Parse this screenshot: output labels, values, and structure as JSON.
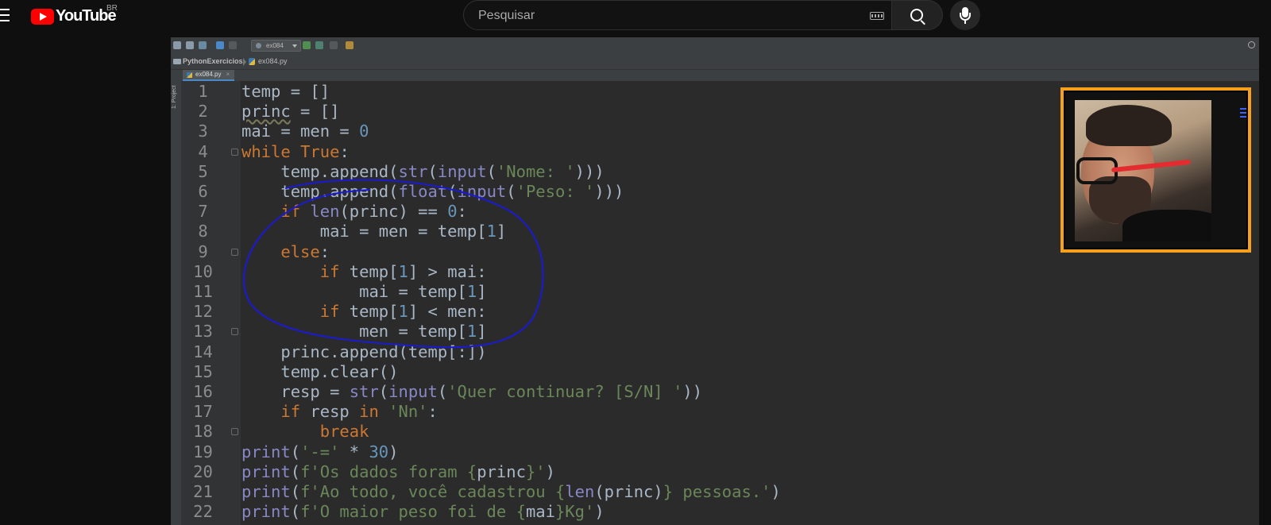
{
  "masthead": {
    "logo_text": "YouTube",
    "country": "BR",
    "search_placeholder": "Pesquisar"
  },
  "ide": {
    "run_config": "ex084",
    "breadcrumb_project": "PythonExercicios",
    "breadcrumb_file": "ex084.py",
    "tab_label": "ex084.py",
    "tab_close": "×",
    "side_label": "1: Project"
  },
  "code_lines": [
    {
      "n": "1",
      "tokens": [
        [
          "",
          "temp = []"
        ]
      ]
    },
    {
      "n": "2",
      "tokens": [
        [
          "sq",
          "princ"
        ],
        [
          "",
          " = []"
        ]
      ]
    },
    {
      "n": "3",
      "tokens": [
        [
          "",
          "mai = men = "
        ],
        [
          "num",
          "0"
        ]
      ]
    },
    {
      "n": "4",
      "tokens": [
        [
          "kw",
          "while"
        ],
        [
          "",
          " "
        ],
        [
          "kw",
          "True"
        ],
        [
          "",
          ":"
        ]
      ],
      "fold": true
    },
    {
      "n": "5",
      "tokens": [
        [
          "",
          "    temp.append("
        ],
        [
          "fn",
          "str"
        ],
        [
          "",
          "("
        ],
        [
          "fn",
          "input"
        ],
        [
          "",
          "("
        ],
        [
          "str",
          "'Nome: '"
        ],
        [
          "",
          ")))"
        ]
      ]
    },
    {
      "n": "6",
      "tokens": [
        [
          "",
          "    temp.append("
        ],
        [
          "fn",
          "float"
        ],
        [
          "",
          "("
        ],
        [
          "fn",
          "input"
        ],
        [
          "",
          "("
        ],
        [
          "str",
          "'Peso: '"
        ],
        [
          "",
          ")))"
        ]
      ]
    },
    {
      "n": "7",
      "tokens": [
        [
          "",
          "    "
        ],
        [
          "kw",
          "if"
        ],
        [
          "",
          " "
        ],
        [
          "fn",
          "len"
        ],
        [
          "",
          "(princ) == "
        ],
        [
          "num",
          "0"
        ],
        [
          "",
          ":"
        ]
      ]
    },
    {
      "n": "8",
      "tokens": [
        [
          "",
          "        mai = men = temp["
        ],
        [
          "num",
          "1"
        ],
        [
          "",
          "]"
        ]
      ]
    },
    {
      "n": "9",
      "tokens": [
        [
          "",
          "    "
        ],
        [
          "kw",
          "else"
        ],
        [
          "",
          ":"
        ]
      ],
      "fold": true
    },
    {
      "n": "10",
      "tokens": [
        [
          "",
          "        "
        ],
        [
          "kw",
          "if"
        ],
        [
          "",
          " temp["
        ],
        [
          "num",
          "1"
        ],
        [
          "",
          "] > mai:"
        ]
      ]
    },
    {
      "n": "11",
      "tokens": [
        [
          "",
          "            mai = temp["
        ],
        [
          "num",
          "1"
        ],
        [
          "",
          "]"
        ]
      ]
    },
    {
      "n": "12",
      "tokens": [
        [
          "",
          "        "
        ],
        [
          "kw",
          "if"
        ],
        [
          "",
          " temp["
        ],
        [
          "num",
          "1"
        ],
        [
          "",
          "] < men:"
        ]
      ]
    },
    {
      "n": "13",
      "tokens": [
        [
          "",
          "            men = temp["
        ],
        [
          "num",
          "1"
        ],
        [
          "",
          "]"
        ]
      ],
      "fold": true
    },
    {
      "n": "14",
      "tokens": [
        [
          "",
          "    princ.append(temp[:])"
        ]
      ]
    },
    {
      "n": "15",
      "tokens": [
        [
          "",
          "    temp.clear()"
        ]
      ]
    },
    {
      "n": "16",
      "tokens": [
        [
          "",
          "    resp = "
        ],
        [
          "fn",
          "str"
        ],
        [
          "",
          "("
        ],
        [
          "fn",
          "input"
        ],
        [
          "",
          "("
        ],
        [
          "str",
          "'Quer continuar? [S/N] '"
        ],
        [
          "",
          "))"
        ]
      ]
    },
    {
      "n": "17",
      "tokens": [
        [
          "",
          "    "
        ],
        [
          "kw",
          "if"
        ],
        [
          "",
          " resp "
        ],
        [
          "kw",
          "in"
        ],
        [
          "",
          " "
        ],
        [
          "str",
          "'Nn'"
        ],
        [
          "",
          ":"
        ]
      ]
    },
    {
      "n": "18",
      "tokens": [
        [
          "",
          "        "
        ],
        [
          "kw",
          "break"
        ]
      ],
      "fold": true
    },
    {
      "n": "19",
      "tokens": [
        [
          "fn",
          "print"
        ],
        [
          "",
          "("
        ],
        [
          "str",
          "'-='"
        ],
        [
          "",
          " * "
        ],
        [
          "num",
          "30"
        ],
        [
          "",
          ")"
        ]
      ]
    },
    {
      "n": "20",
      "tokens": [
        [
          "fn",
          "print"
        ],
        [
          "",
          "("
        ],
        [
          "str",
          "f'Os dados foram {"
        ],
        [
          "",
          "princ"
        ],
        [
          "str",
          "}'"
        ],
        [
          "",
          ")"
        ]
      ]
    },
    {
      "n": "21",
      "tokens": [
        [
          "fn",
          "print"
        ],
        [
          "",
          "("
        ],
        [
          "str",
          "f'Ao todo, você cadastrou {"
        ],
        [
          "fn",
          "len"
        ],
        [
          "",
          "(princ)"
        ],
        [
          "str",
          "} pessoas.'"
        ],
        [
          "",
          ")"
        ]
      ]
    },
    {
      "n": "22",
      "tokens": [
        [
          "fn",
          "print"
        ],
        [
          "",
          "("
        ],
        [
          "str",
          "f'O maior peso foi de {"
        ],
        [
          "",
          "mai"
        ],
        [
          "str",
          "}Kg'"
        ],
        [
          "",
          ")"
        ]
      ]
    }
  ],
  "colors": {
    "keyword": "#cc7832",
    "string": "#6a8759",
    "number": "#6897bb",
    "builtin": "#8888c6",
    "text": "#a9b7c6",
    "annotation_circle": "#1a1ad6",
    "facecam_border": "#f6a01c"
  },
  "icons": [
    "menu-icon",
    "youtube-play-icon",
    "keyboard-icon",
    "search-icon",
    "microphone-icon",
    "folder-icon",
    "python-file-icon",
    "run-icon",
    "debug-icon",
    "stop-icon"
  ]
}
